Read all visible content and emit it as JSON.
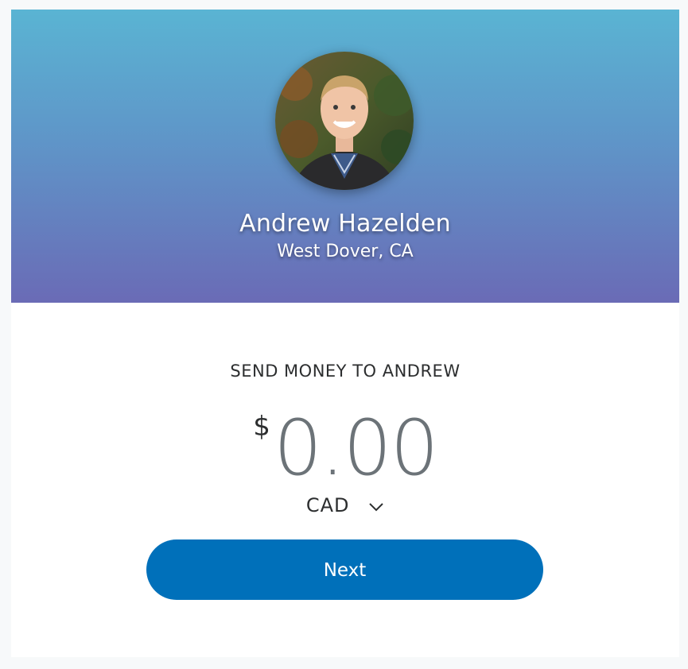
{
  "profile": {
    "name": "Andrew Hazelden",
    "location": "West Dover, CA",
    "avatar_icon": "profile-photo"
  },
  "send": {
    "title": "SEND MONEY TO ANDREW",
    "currency_symbol": "$",
    "amount": "0.00",
    "currency_code": "CAD",
    "currency_icon": "chevron-down-icon"
  },
  "actions": {
    "next_label": "Next"
  },
  "colors": {
    "hero_top": "#5ab4d3",
    "hero_bottom": "#6a6bb6",
    "button": "#0070ba",
    "amount": "#6c7378"
  }
}
